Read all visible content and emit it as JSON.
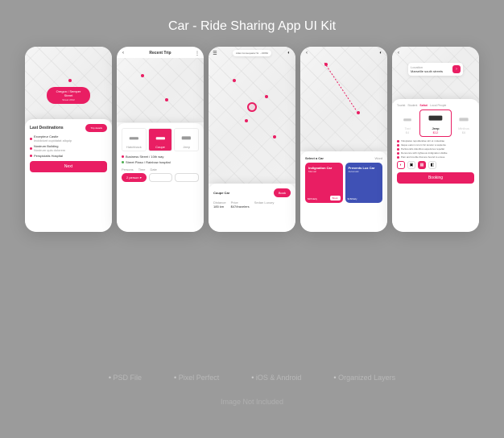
{
  "title": "Car - Ride Sharing App UI Kit",
  "features": [
    "PSD File",
    "Pixel Perfect",
    "iOS & Android",
    "Organized Layers"
  ],
  "disclaimer": "Image Not Included",
  "screen1": {
    "location_chip": "Oregon / Semper Street",
    "location_sub": "Street 2432",
    "section_title": "Last Destinations",
    "trip_button": "Trip details",
    "dest1": "Excepteur Castle",
    "dest1_sub": "Incididunt cupidatat aliquip",
    "dest2": "Nostrum Building",
    "dest2_sub": "Nostrum quis dolorem",
    "dest3": "Perspiciatis Hospital",
    "next": "Next"
  },
  "screen2": {
    "header": "Recent Trip",
    "cars": [
      "Hatchback",
      "Coupe",
      "Jeep"
    ],
    "addr1": "Business Street / 10th way",
    "addr2": "Street Plaso / Rainbow hospital",
    "labels": [
      "Persons",
      "Time",
      "Date"
    ],
    "persons_pill": "2 person"
  },
  "screen3": {
    "search": "Atlas Consequator Sr. - 23652",
    "car_type": "Coupe Car",
    "car_btn": "Book",
    "col1_label": "Distance",
    "col1_val": "185 km",
    "col2_label": "Price",
    "col2_val": "$47/travelers",
    "col3_label": "Sedan Luxury"
  },
  "screen4": {
    "section": "Select a Car",
    "word": "Word",
    "card1_title": "Indignation Car",
    "card1_sub": "Manual",
    "card1_price": "$26/daily",
    "card1_btn": "Book",
    "card2_title": "Prevents Lux Car",
    "card2_sub": "Automatic",
    "card2_price": "$18/daily"
  },
  "screen5": {
    "loc_label": "Location",
    "loc_val": "Marseille south streets",
    "tabs": [
      "Tourist",
      "Student",
      "Safari",
      "Local People"
    ],
    "car_main": "Jeep",
    "car_sub": "$12",
    "car_left": "Taxi",
    "car_left_sub": "$4",
    "car_right": "Minibus",
    "car_right_sub": "$8",
    "b1": "Voluptates repudiandae sint et molestiae",
    "b2": "Itaque earum rerum hic tenetur a sapiente",
    "b3": "Perferendis doloribus asperiores repellat",
    "b4": "Denounce with righteous indignation dislike",
    "b5": "Pain and trouble that are bound to ensue",
    "book": "Booking"
  }
}
